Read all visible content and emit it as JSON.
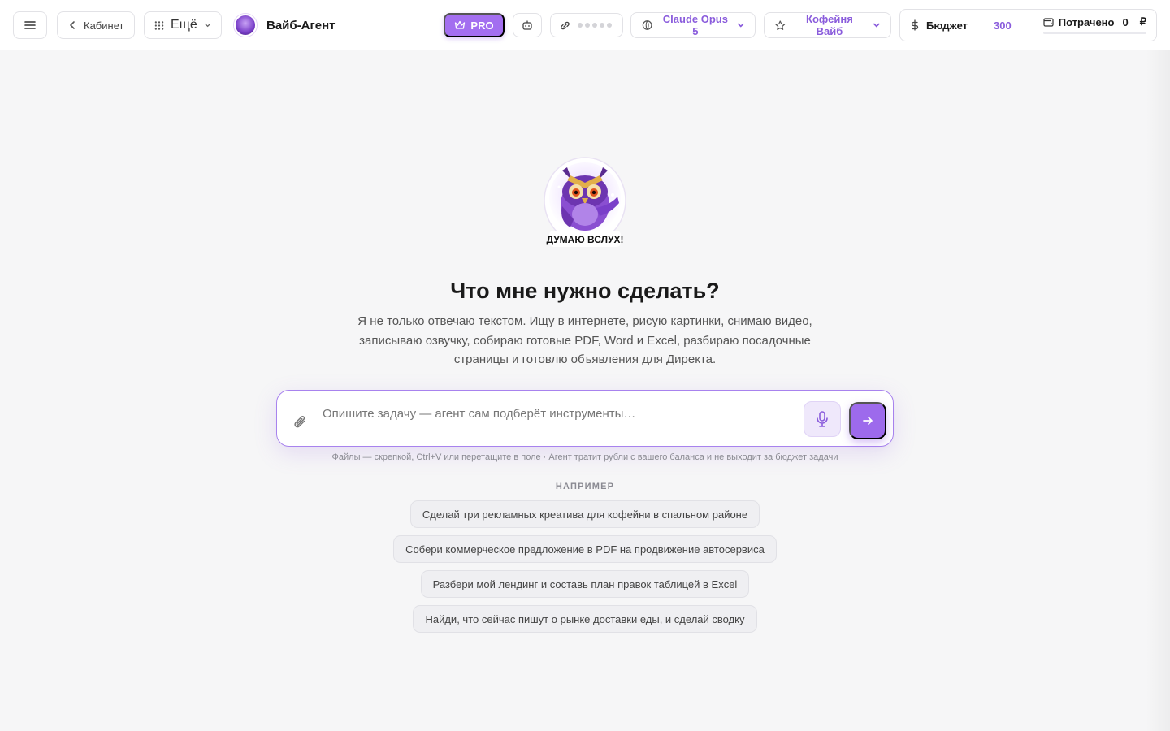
{
  "header": {
    "back_label": "Кабинет",
    "more_label": "Ещё",
    "brand_name": "Вайб-Агент",
    "pro_label": "PRO",
    "model_label": "Claude Opus 5",
    "project_label": "Кофейня Вайб",
    "budget_label": "Бюджет",
    "budget_value": "300",
    "spent_label": "Потрачено",
    "spent_value": "0",
    "currency": "₽"
  },
  "main": {
    "mascot_caption": "ДУМАЮ ВСЛУХ!",
    "title": "Что мне нужно сделать?",
    "subtitle": "Я не только отвечаю текстом. Ищу в интернете, рисую картинки, снимаю видео, записываю озвучку, собираю готовые PDF, Word и Excel, разбираю посадочные страницы и готовлю объявления для Директа.",
    "input_placeholder": "Опишите задачу — агент сам подберёт инструменты…",
    "hint": "Файлы — скрепкой, Ctrl+V или перетащите в поле · Агент тратит рубли с вашего баланса и не выходит за бюджет задачи",
    "examples_label": "НАПРИМЕР",
    "examples": [
      "Сделай три рекламных креатива для кофейни в спальном районе",
      "Собери коммерческое предложение в PDF на продвижение автосервиса",
      "Разбери мой лендинг и составь план правок таблицей в Excel",
      "Найди, что сейчас пишут о рынке доставки еды, и сделай сводку"
    ]
  },
  "colors": {
    "accent": "#9d6aec",
    "accent_text": "#8a5cdc",
    "background": "#f6f6f7"
  },
  "icons": [
    "menu-icon",
    "chevron-left-icon",
    "grid-icon",
    "chevron-down-icon",
    "crown-icon",
    "robot-icon",
    "link-icon",
    "sparkle-icon",
    "star-icon",
    "dollar-icon",
    "wallet-icon",
    "paperclip-icon",
    "microphone-icon",
    "arrow-right-icon"
  ]
}
